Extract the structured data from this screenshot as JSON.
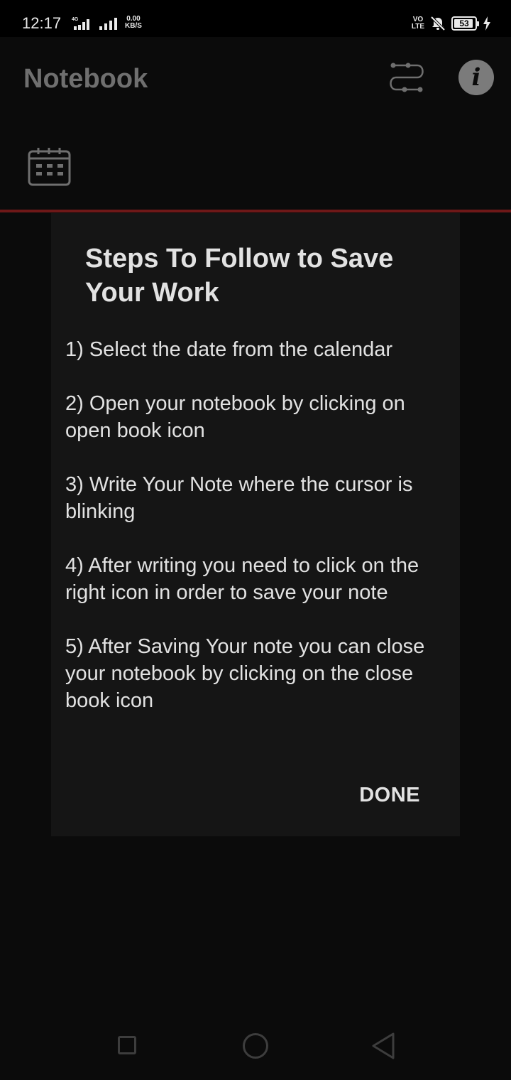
{
  "status_bar": {
    "time": "12:17",
    "network_type": "4G",
    "net_speed_value": "0.00",
    "net_speed_unit": "KB/S",
    "volte_top": "VO",
    "volte_bottom": "LTE",
    "battery_level": "53",
    "icons": [
      "signal-icon",
      "signal-icon",
      "volte-icon",
      "mute-icon",
      "battery-icon",
      "charging-icon"
    ]
  },
  "app_bar": {
    "title": "Notebook",
    "icons": [
      "sync-icon",
      "info-icon",
      "calendar-icon"
    ]
  },
  "dialog": {
    "title": "Steps To Follow to Save Your Work",
    "steps": [
      "1) Select the date from the calendar",
      "2) Open your notebook by clicking on open book icon",
      "3) Write Your Note where the cursor is blinking",
      "4) After writing you need to click on the right icon in order to save your note",
      "5) After Saving Your note you can close your notebook by clicking on the close book icon"
    ],
    "done_label": "DONE"
  },
  "colors": {
    "background": "#0b0b0b",
    "dialog_background": "#151515",
    "divider": "#6e1818",
    "text": "#e2e2e2",
    "dimmed": "#6f6f6f"
  }
}
